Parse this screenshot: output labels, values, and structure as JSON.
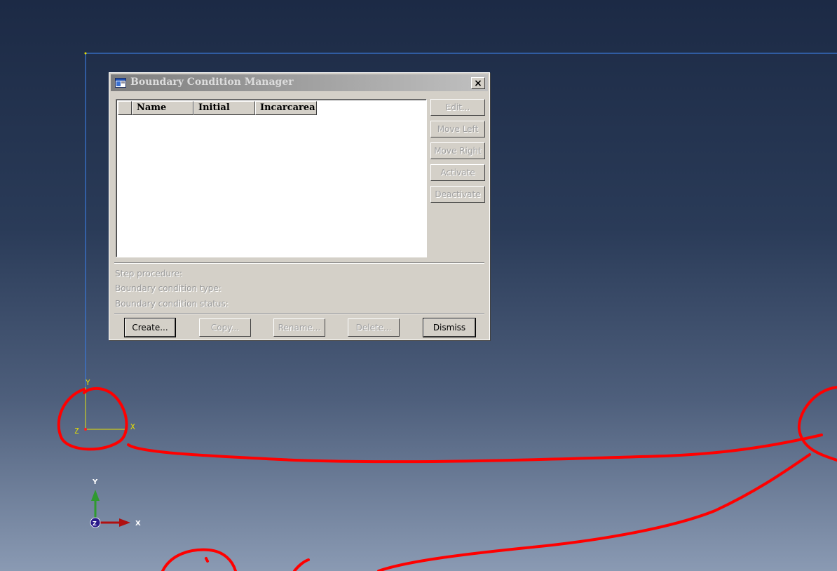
{
  "viewport": {
    "model_triad": {
      "y_label": "Y",
      "x_label": "X",
      "z_label": "Z"
    },
    "view_triad": {
      "y_label": "Y",
      "x_label": "X",
      "z_label": "Z"
    },
    "colors": {
      "model_outline": "#3a78d8",
      "model_axis": "#e8e000",
      "annotation": "#ff0000",
      "triad_y": "#2f9a2f",
      "triad_x": "#b01010",
      "triad_z": "#2a1a8a"
    }
  },
  "dialog": {
    "title": "Boundary Condition Manager",
    "close_label": "×",
    "columns": [
      "Name",
      "Initial",
      "Incarcarea"
    ],
    "side_buttons": [
      "Edit...",
      "Move Left",
      "Move Right",
      "Activate",
      "Deactivate"
    ],
    "info": {
      "step_procedure": "Step procedure:",
      "bc_type": "Boundary condition type:",
      "bc_status": "Boundary condition status:"
    },
    "bottom_buttons": {
      "create": "Create...",
      "copy": "Copy...",
      "rename": "Rename...",
      "delete": "Delete...",
      "dismiss": "Dismiss"
    }
  }
}
